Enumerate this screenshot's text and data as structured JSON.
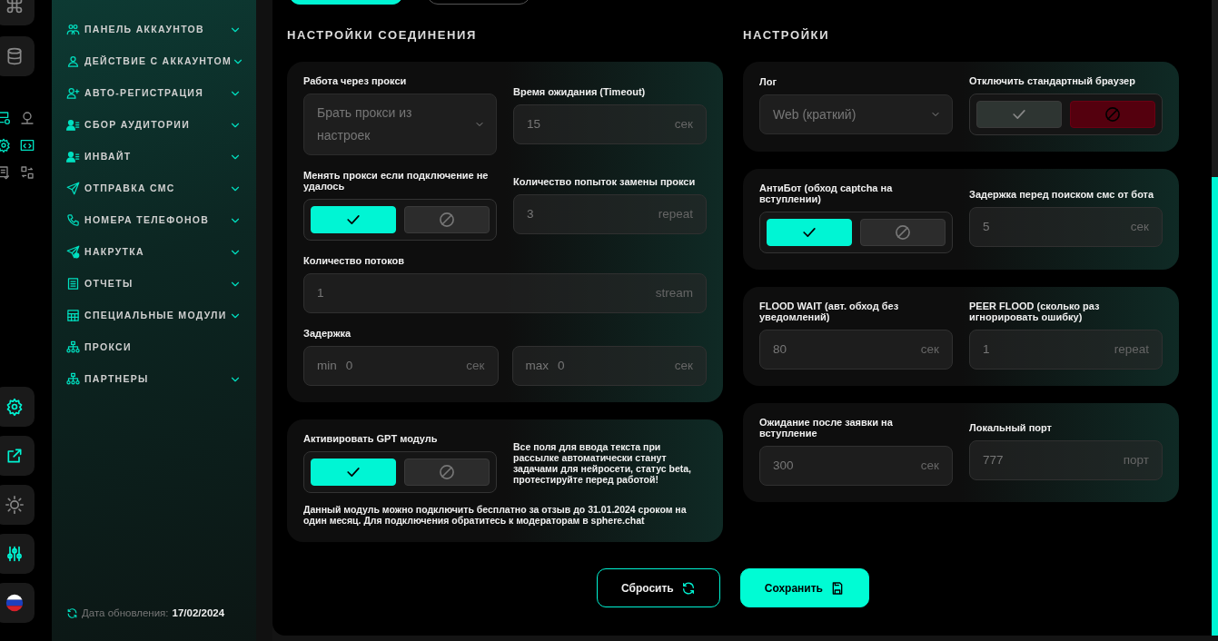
{
  "tabs": [
    {
      "selected": true
    },
    {
      "selected": false
    }
  ],
  "sidebar": {
    "items": [
      {
        "label": "ПАНЕЛЬ АККАУНТОВ",
        "expandable": true
      },
      {
        "label": "ДЕЙСТВИЕ С АККАУНТОМ",
        "expandable": true
      },
      {
        "label": "АВТО-РЕГИСТРАЦИЯ",
        "expandable": true
      },
      {
        "label": "СБОР АУДИТОРИИ",
        "expandable": true
      },
      {
        "label": "ИНВАЙТ",
        "expandable": true
      },
      {
        "label": "ОТПРАВКА СМС",
        "expandable": true
      },
      {
        "label": "НОМЕРА ТЕЛЕФОНОВ",
        "expandable": true
      },
      {
        "label": "НАКРУТКА",
        "expandable": true
      },
      {
        "label": "ОТЧЕТЫ",
        "expandable": true
      },
      {
        "label": "СПЕЦИАЛЬНЫЕ МОДУЛИ",
        "expandable": true
      },
      {
        "label": "ПРОКСИ",
        "expandable": false
      },
      {
        "label": "ПАРТНЕРЫ",
        "expandable": true
      }
    ],
    "update_label": "Дата обновления:",
    "update_date": "17/02/2024"
  },
  "sections": [
    {
      "title": "НАСТРОЙКИ СОЕДИНЕНИЯ",
      "cards": [
        {
          "rows": [
            {
              "fields": [
                {
                  "kind": "select",
                  "label": "Работа через прокси",
                  "value": "Брать прокси из настроек"
                },
                {
                  "kind": "number",
                  "label": "Время ожидания (Timeout)",
                  "value": "15",
                  "unit": "сек"
                }
              ]
            },
            {
              "fields": [
                {
                  "kind": "toggle",
                  "label": "Менять прокси если подключение не удалось",
                  "on": true
                },
                {
                  "kind": "number",
                  "label": "Количество попыток замены прокси",
                  "value": "3",
                  "unit": "repeat"
                }
              ]
            },
            {
              "fields": [
                {
                  "kind": "number",
                  "label": "Количество потоков",
                  "value": "1",
                  "unit": "stream"
                }
              ]
            },
            {
              "fields": [
                {
                  "kind": "range",
                  "label": "Задержка",
                  "inputs": [
                    {
                      "prefix": "min",
                      "value": "0",
                      "unit": "сек"
                    },
                    {
                      "prefix": "max",
                      "value": "0",
                      "unit": "сек"
                    }
                  ]
                }
              ]
            }
          ]
        },
        {
          "rows": [
            {
              "fields": [
                {
                  "kind": "toggle",
                  "label": "Активировать GPT модуль",
                  "on": true
                },
                {
                  "kind": "note",
                  "text": "Все поля для ввода текста при рассылке автоматически станут задачами для нейросети, статус beta, протестируйте перед работой!"
                }
              ]
            }
          ],
          "footnote": "Данный модуль можно подключить бесплатно за отзыв до 31.01.2024 сроком на один месяц. Для подключения обратитесь к модераторам в sphere.chat"
        }
      ]
    },
    {
      "title": "НАСТРОЙКИ",
      "cards": [
        {
          "rows": [
            {
              "fields": [
                {
                  "kind": "select",
                  "label": "Лог",
                  "value": "Web (краткий)"
                },
                {
                  "kind": "toggle",
                  "label": "Отключить стандартный браузер",
                  "on": false
                }
              ]
            }
          ]
        },
        {
          "rows": [
            {
              "fields": [
                {
                  "kind": "toggle",
                  "label": "АнтиБот (обход captcha на вступлении)",
                  "on": true
                },
                {
                  "kind": "number",
                  "label": "Задержка перед поиском смс от бота",
                  "value": "5",
                  "unit": "сек"
                }
              ]
            }
          ]
        },
        {
          "rows": [
            {
              "fields": [
                {
                  "kind": "number",
                  "label": "FLOOD WAIT (авт. обход без уведомлений)",
                  "value": "80",
                  "unit": "сек"
                },
                {
                  "kind": "number",
                  "label": "PEER FLOOD (сколько раз игнорировать ошибку)",
                  "value": "1",
                  "unit": "repeat"
                }
              ]
            }
          ]
        },
        {
          "rows": [
            {
              "fields": [
                {
                  "kind": "number",
                  "label": "Ожидание после заявки на вступление",
                  "value": "300",
                  "unit": "сек"
                },
                {
                  "kind": "number",
                  "label": "Локальный порт",
                  "value": "777",
                  "unit": "порт"
                }
              ]
            }
          ]
        }
      ]
    }
  ],
  "actions": [
    {
      "label": "Сбросить",
      "kind": "reset"
    },
    {
      "label": "Сохранить",
      "kind": "save"
    }
  ]
}
